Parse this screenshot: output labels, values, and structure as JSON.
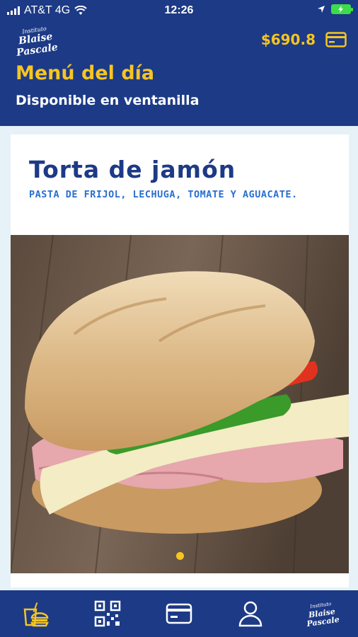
{
  "status_bar": {
    "carrier": "AT&T 4G",
    "time": "12:26"
  },
  "header": {
    "logo_line1": "Instituto",
    "logo_line2": "Blaise Pascale",
    "balance": "$690.8",
    "title": "Menú del día",
    "subtitle": "Disponible en ventanilla"
  },
  "menu_item": {
    "name": "Torta de jamón",
    "description": "PASTA DE FRIJOL, LECHUGA, TOMATE Y AGUACATE.",
    "carousel_pages": 1,
    "carousel_active": 1
  },
  "tabbar": {
    "items": [
      "menu-icon",
      "qr-code-icon",
      "card-icon",
      "profile-icon",
      "logo"
    ]
  },
  "colors": {
    "primary": "#1d3a86",
    "accent": "#f6c522",
    "description": "#2a6fd0",
    "background": "#e6f2f8"
  }
}
